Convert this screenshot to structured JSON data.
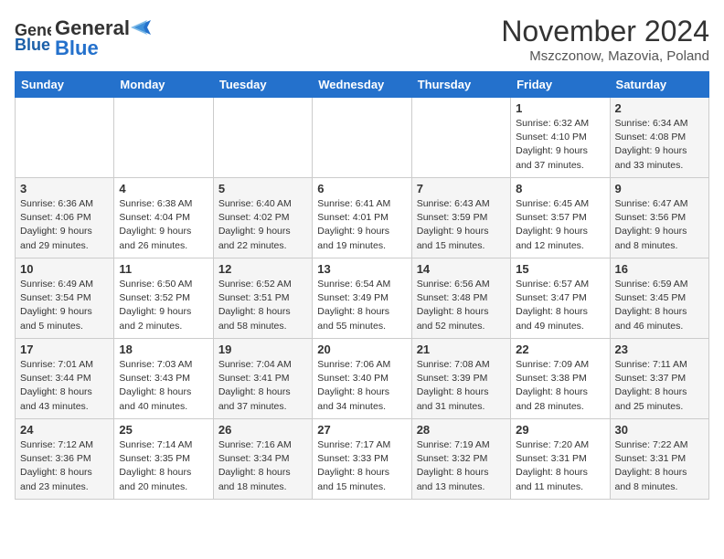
{
  "logo": {
    "general": "General",
    "blue": "Blue"
  },
  "title": "November 2024",
  "location": "Mszczonow, Mazovia, Poland",
  "days_of_week": [
    "Sunday",
    "Monday",
    "Tuesday",
    "Wednesday",
    "Thursday",
    "Friday",
    "Saturday"
  ],
  "weeks": [
    [
      {
        "day": "",
        "info": ""
      },
      {
        "day": "",
        "info": ""
      },
      {
        "day": "",
        "info": ""
      },
      {
        "day": "",
        "info": ""
      },
      {
        "day": "",
        "info": ""
      },
      {
        "day": "1",
        "info": "Sunrise: 6:32 AM\nSunset: 4:10 PM\nDaylight: 9 hours\nand 37 minutes."
      },
      {
        "day": "2",
        "info": "Sunrise: 6:34 AM\nSunset: 4:08 PM\nDaylight: 9 hours\nand 33 minutes."
      }
    ],
    [
      {
        "day": "3",
        "info": "Sunrise: 6:36 AM\nSunset: 4:06 PM\nDaylight: 9 hours\nand 29 minutes."
      },
      {
        "day": "4",
        "info": "Sunrise: 6:38 AM\nSunset: 4:04 PM\nDaylight: 9 hours\nand 26 minutes."
      },
      {
        "day": "5",
        "info": "Sunrise: 6:40 AM\nSunset: 4:02 PM\nDaylight: 9 hours\nand 22 minutes."
      },
      {
        "day": "6",
        "info": "Sunrise: 6:41 AM\nSunset: 4:01 PM\nDaylight: 9 hours\nand 19 minutes."
      },
      {
        "day": "7",
        "info": "Sunrise: 6:43 AM\nSunset: 3:59 PM\nDaylight: 9 hours\nand 15 minutes."
      },
      {
        "day": "8",
        "info": "Sunrise: 6:45 AM\nSunset: 3:57 PM\nDaylight: 9 hours\nand 12 minutes."
      },
      {
        "day": "9",
        "info": "Sunrise: 6:47 AM\nSunset: 3:56 PM\nDaylight: 9 hours\nand 8 minutes."
      }
    ],
    [
      {
        "day": "10",
        "info": "Sunrise: 6:49 AM\nSunset: 3:54 PM\nDaylight: 9 hours\nand 5 minutes."
      },
      {
        "day": "11",
        "info": "Sunrise: 6:50 AM\nSunset: 3:52 PM\nDaylight: 9 hours\nand 2 minutes."
      },
      {
        "day": "12",
        "info": "Sunrise: 6:52 AM\nSunset: 3:51 PM\nDaylight: 8 hours\nand 58 minutes."
      },
      {
        "day": "13",
        "info": "Sunrise: 6:54 AM\nSunset: 3:49 PM\nDaylight: 8 hours\nand 55 minutes."
      },
      {
        "day": "14",
        "info": "Sunrise: 6:56 AM\nSunset: 3:48 PM\nDaylight: 8 hours\nand 52 minutes."
      },
      {
        "day": "15",
        "info": "Sunrise: 6:57 AM\nSunset: 3:47 PM\nDaylight: 8 hours\nand 49 minutes."
      },
      {
        "day": "16",
        "info": "Sunrise: 6:59 AM\nSunset: 3:45 PM\nDaylight: 8 hours\nand 46 minutes."
      }
    ],
    [
      {
        "day": "17",
        "info": "Sunrise: 7:01 AM\nSunset: 3:44 PM\nDaylight: 8 hours\nand 43 minutes."
      },
      {
        "day": "18",
        "info": "Sunrise: 7:03 AM\nSunset: 3:43 PM\nDaylight: 8 hours\nand 40 minutes."
      },
      {
        "day": "19",
        "info": "Sunrise: 7:04 AM\nSunset: 3:41 PM\nDaylight: 8 hours\nand 37 minutes."
      },
      {
        "day": "20",
        "info": "Sunrise: 7:06 AM\nSunset: 3:40 PM\nDaylight: 8 hours\nand 34 minutes."
      },
      {
        "day": "21",
        "info": "Sunrise: 7:08 AM\nSunset: 3:39 PM\nDaylight: 8 hours\nand 31 minutes."
      },
      {
        "day": "22",
        "info": "Sunrise: 7:09 AM\nSunset: 3:38 PM\nDaylight: 8 hours\nand 28 minutes."
      },
      {
        "day": "23",
        "info": "Sunrise: 7:11 AM\nSunset: 3:37 PM\nDaylight: 8 hours\nand 25 minutes."
      }
    ],
    [
      {
        "day": "24",
        "info": "Sunrise: 7:12 AM\nSunset: 3:36 PM\nDaylight: 8 hours\nand 23 minutes."
      },
      {
        "day": "25",
        "info": "Sunrise: 7:14 AM\nSunset: 3:35 PM\nDaylight: 8 hours\nand 20 minutes."
      },
      {
        "day": "26",
        "info": "Sunrise: 7:16 AM\nSunset: 3:34 PM\nDaylight: 8 hours\nand 18 minutes."
      },
      {
        "day": "27",
        "info": "Sunrise: 7:17 AM\nSunset: 3:33 PM\nDaylight: 8 hours\nand 15 minutes."
      },
      {
        "day": "28",
        "info": "Sunrise: 7:19 AM\nSunset: 3:32 PM\nDaylight: 8 hours\nand 13 minutes."
      },
      {
        "day": "29",
        "info": "Sunrise: 7:20 AM\nSunset: 3:31 PM\nDaylight: 8 hours\nand 11 minutes."
      },
      {
        "day": "30",
        "info": "Sunrise: 7:22 AM\nSunset: 3:31 PM\nDaylight: 8 hours\nand 8 minutes."
      }
    ]
  ]
}
